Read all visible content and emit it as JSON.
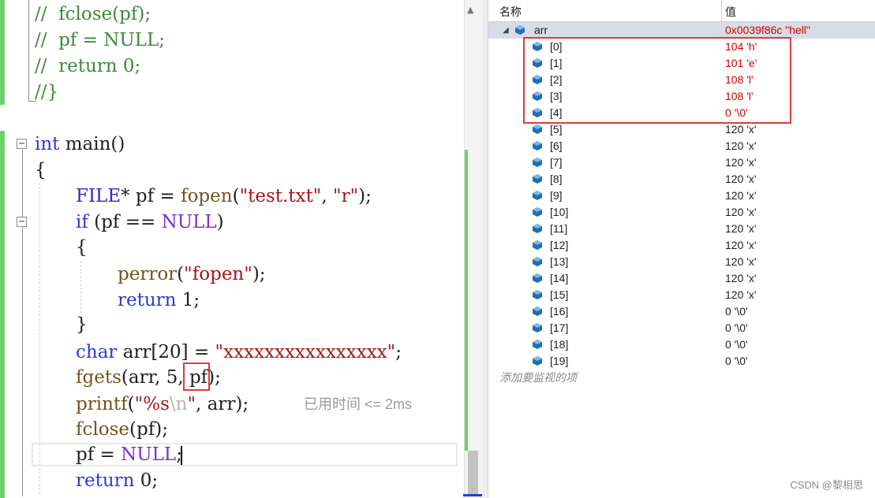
{
  "editor": {
    "lines": [
      {
        "id": "l1",
        "text": "//  fclose(pf);"
      },
      {
        "id": "l2",
        "text": "//  pf = NULL;"
      },
      {
        "id": "l3",
        "text": "//  return 0;"
      },
      {
        "id": "l4",
        "text": "//}"
      }
    ],
    "main_sig": {
      "kw": "int",
      "name": "main()"
    },
    "open_brace": "{",
    "file_line": {
      "type": "FILE",
      "rest1": "* pf = ",
      "fn": "fopen",
      "paren": "(",
      "s1": "\"test.txt\"",
      "comma": ", ",
      "s2": "\"r\"",
      "end": ");"
    },
    "if_line": {
      "kw": "if",
      "rest1": " (pf == ",
      "macro": "NULL",
      "end": ")"
    },
    "if_open": "{",
    "perror_line": {
      "fn": "perror",
      "open": "(",
      "str": "\"fopen\"",
      "end": ");"
    },
    "return1_line": {
      "kw": "return",
      "rest": " 1;"
    },
    "if_close": "}",
    "char_line": {
      "kw": "char",
      "rest": " arr[20] = ",
      "str": "\"xxxxxxxxxxxxxxxx\"",
      "end": ";"
    },
    "fgets_line": {
      "fn": "fgets",
      "p1": "(arr, ",
      "num": "5",
      "p2": ", pf);"
    },
    "printf_line": {
      "fn": "printf",
      "p1": "(",
      "s1": "\"%s",
      "esc": "\\n",
      "s2": "\"",
      "p2": ", arr);"
    },
    "fclose_line": {
      "fn": "fclose",
      "rest": "(pf);"
    },
    "pf_line": {
      "rest": "pf = ",
      "macro": "NULL",
      "end": ";"
    },
    "return0_line": {
      "kw": "return",
      "rest": " 0;"
    },
    "perf_tip": "已用时间 <= 2ms",
    "fold_minus": "−"
  },
  "watch": {
    "header": {
      "name": "名称",
      "value": "值"
    },
    "root": {
      "name": "arr",
      "value": "0x0039f86c \"hell\""
    },
    "items": [
      {
        "name": "[0]",
        "value": "104 'h'",
        "changed": true
      },
      {
        "name": "[1]",
        "value": "101 'e'",
        "changed": true
      },
      {
        "name": "[2]",
        "value": "108 'l'",
        "changed": true
      },
      {
        "name": "[3]",
        "value": "108 'l'",
        "changed": true
      },
      {
        "name": "[4]",
        "value": "0 '\\0'",
        "changed": true
      },
      {
        "name": "[5]",
        "value": "120 'x'",
        "changed": false
      },
      {
        "name": "[6]",
        "value": "120 'x'",
        "changed": false
      },
      {
        "name": "[7]",
        "value": "120 'x'",
        "changed": false
      },
      {
        "name": "[8]",
        "value": "120 'x'",
        "changed": false
      },
      {
        "name": "[9]",
        "value": "120 'x'",
        "changed": false
      },
      {
        "name": "[10]",
        "value": "120 'x'",
        "changed": false
      },
      {
        "name": "[11]",
        "value": "120 'x'",
        "changed": false
      },
      {
        "name": "[12]",
        "value": "120 'x'",
        "changed": false
      },
      {
        "name": "[13]",
        "value": "120 'x'",
        "changed": false
      },
      {
        "name": "[14]",
        "value": "120 'x'",
        "changed": false
      },
      {
        "name": "[15]",
        "value": "120 'x'",
        "changed": false
      },
      {
        "name": "[16]",
        "value": "0 '\\0'",
        "changed": false
      },
      {
        "name": "[17]",
        "value": "0 '\\0'",
        "changed": false
      },
      {
        "name": "[18]",
        "value": "0 '\\0'",
        "changed": false
      },
      {
        "name": "[19]",
        "value": "0 '\\0'",
        "changed": false
      }
    ],
    "add_hint": "添加要监视的项"
  },
  "watermark": "CSDN @黎相思",
  "colors": {
    "changed_value": "#d10000",
    "highlight_box": "#e03a3a",
    "change_bar": "#6fd16f"
  }
}
